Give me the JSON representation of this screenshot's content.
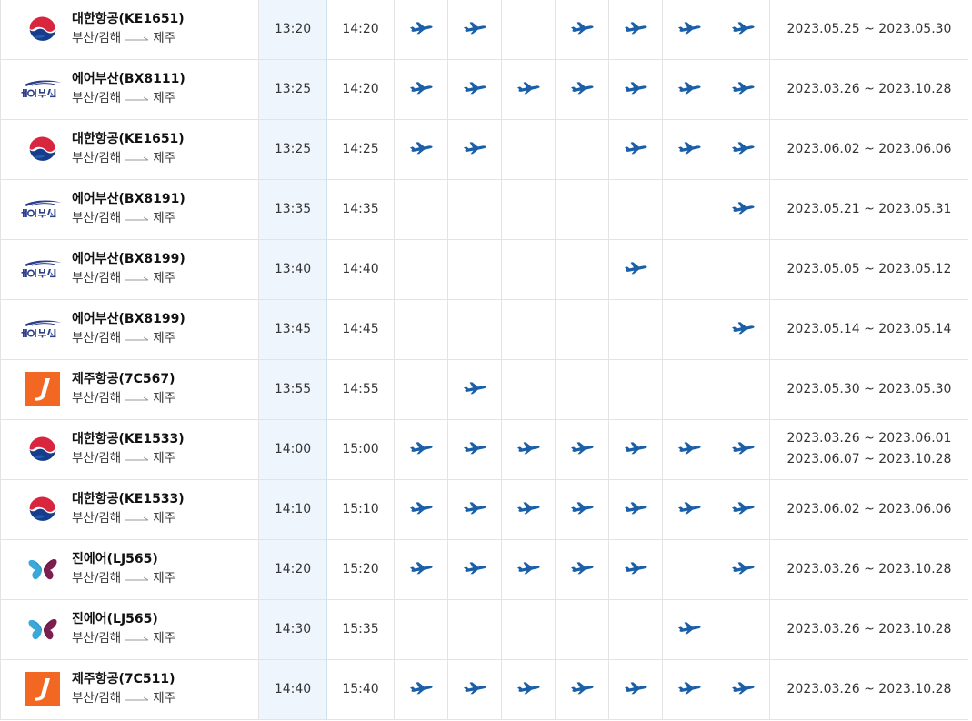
{
  "route": {
    "from": "부산/김해",
    "to": "제주"
  },
  "airline_logos": {
    "KE": "korean-air-taegeuk-logo",
    "BX": "air-busan-logo",
    "7C": "jeju-air-j-logo",
    "LJ": "jin-air-butterfly-logo"
  },
  "colors": {
    "plane_icon": "#1a5fa8",
    "departure_column_bg": "#eef5fd",
    "row_border": "#e3e3e3"
  },
  "flights": [
    {
      "airline": "대한항공(KE1651)",
      "code": "KE",
      "dep": "13:20",
      "arr": "14:20",
      "days": [
        1,
        1,
        0,
        1,
        1,
        1,
        1
      ],
      "periods": [
        "2023.05.25 ~ 2023.05.30"
      ]
    },
    {
      "airline": "에어부산(BX8111)",
      "code": "BX",
      "dep": "13:25",
      "arr": "14:20",
      "days": [
        1,
        1,
        1,
        1,
        1,
        1,
        1
      ],
      "periods": [
        "2023.03.26 ~ 2023.10.28"
      ]
    },
    {
      "airline": "대한항공(KE1651)",
      "code": "KE",
      "dep": "13:25",
      "arr": "14:25",
      "days": [
        1,
        1,
        0,
        0,
        1,
        1,
        1
      ],
      "periods": [
        "2023.06.02 ~ 2023.06.06"
      ]
    },
    {
      "airline": "에어부산(BX8191)",
      "code": "BX",
      "dep": "13:35",
      "arr": "14:35",
      "days": [
        0,
        0,
        0,
        0,
        0,
        0,
        1
      ],
      "periods": [
        "2023.05.21 ~ 2023.05.31"
      ]
    },
    {
      "airline": "에어부산(BX8199)",
      "code": "BX",
      "dep": "13:40",
      "arr": "14:40",
      "days": [
        0,
        0,
        0,
        0,
        1,
        0,
        0
      ],
      "periods": [
        "2023.05.05 ~ 2023.05.12"
      ]
    },
    {
      "airline": "에어부산(BX8199)",
      "code": "BX",
      "dep": "13:45",
      "arr": "14:45",
      "days": [
        0,
        0,
        0,
        0,
        0,
        0,
        1
      ],
      "periods": [
        "2023.05.14 ~ 2023.05.14"
      ]
    },
    {
      "airline": "제주항공(7C567)",
      "code": "7C",
      "dep": "13:55",
      "arr": "14:55",
      "days": [
        0,
        1,
        0,
        0,
        0,
        0,
        0
      ],
      "periods": [
        "2023.05.30 ~ 2023.05.30"
      ]
    },
    {
      "airline": "대한항공(KE1533)",
      "code": "KE",
      "dep": "14:00",
      "arr": "15:00",
      "days": [
        1,
        1,
        1,
        1,
        1,
        1,
        1
      ],
      "periods": [
        "2023.03.26 ~ 2023.06.01",
        "2023.06.07 ~ 2023.10.28"
      ]
    },
    {
      "airline": "대한항공(KE1533)",
      "code": "KE",
      "dep": "14:10",
      "arr": "15:10",
      "days": [
        1,
        1,
        1,
        1,
        1,
        1,
        1
      ],
      "periods": [
        "2023.06.02 ~ 2023.06.06"
      ]
    },
    {
      "airline": "진에어(LJ565)",
      "code": "LJ",
      "dep": "14:20",
      "arr": "15:20",
      "days": [
        1,
        1,
        1,
        1,
        1,
        0,
        1
      ],
      "periods": [
        "2023.03.26 ~ 2023.10.28"
      ]
    },
    {
      "airline": "진에어(LJ565)",
      "code": "LJ",
      "dep": "14:30",
      "arr": "15:35",
      "days": [
        0,
        0,
        0,
        0,
        0,
        1,
        0
      ],
      "periods": [
        "2023.03.26 ~ 2023.10.28"
      ]
    },
    {
      "airline": "제주항공(7C511)",
      "code": "7C",
      "dep": "14:40",
      "arr": "15:40",
      "days": [
        1,
        1,
        1,
        1,
        1,
        1,
        1
      ],
      "periods": [
        "2023.03.26 ~ 2023.10.28"
      ]
    }
  ]
}
